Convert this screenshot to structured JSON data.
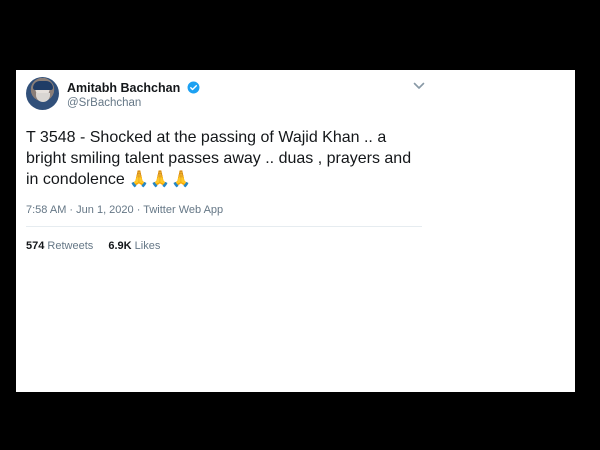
{
  "tweet": {
    "author_name": "Amitabh Bachchan",
    "handle": "@SrBachchan",
    "text": "T 3548 - Shocked at the passing of Wajid Khan .. a bright smiling talent passes away .. duas , prayers and in condolence",
    "emoji": "🙏🙏🙏",
    "time": "7:58 AM",
    "separator": "·",
    "date": "Jun 1, 2020",
    "source": "Twitter Web App",
    "retweets_count": "574",
    "retweets_label": "Retweets",
    "likes_count": "6.9K",
    "likes_label": "Likes"
  },
  "colors": {
    "verified": "#1da1f2",
    "secondary_text": "#657786",
    "primary_text": "#14171a"
  }
}
